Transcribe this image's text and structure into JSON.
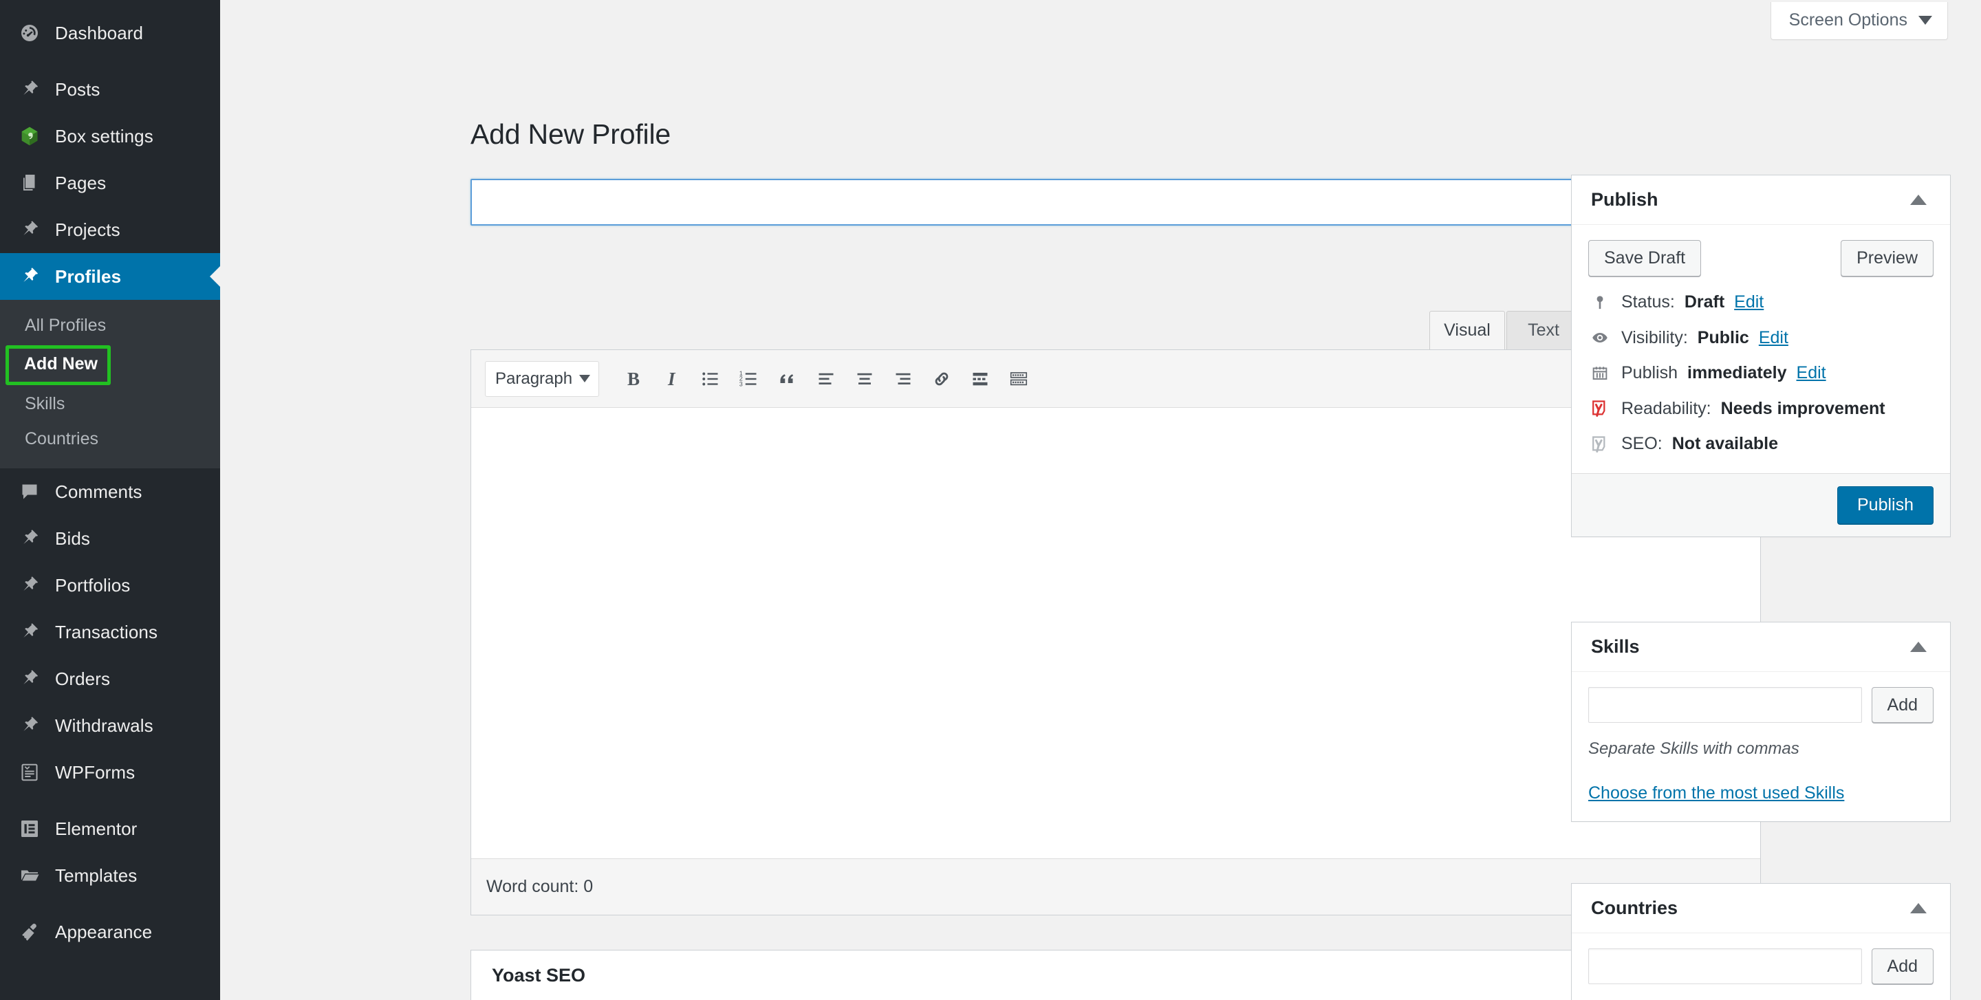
{
  "sidebar": {
    "items": [
      {
        "label": "Dashboard",
        "icon": "dashboard-icon",
        "slug": "dashboard"
      },
      {
        "label": "Posts",
        "icon": "pin-icon",
        "slug": "posts"
      },
      {
        "label": "Box settings",
        "icon": "green-cube-icon",
        "slug": "box-settings"
      },
      {
        "label": "Pages",
        "icon": "pages-icon",
        "slug": "pages"
      },
      {
        "label": "Projects",
        "icon": "pin-icon",
        "slug": "projects"
      },
      {
        "label": "Profiles",
        "icon": "pin-icon",
        "slug": "profiles",
        "active": true
      },
      {
        "label": "Comments",
        "icon": "comment-icon",
        "slug": "comments"
      },
      {
        "label": "Bids",
        "icon": "pin-icon",
        "slug": "bids"
      },
      {
        "label": "Portfolios",
        "icon": "pin-icon",
        "slug": "portfolios"
      },
      {
        "label": "Transactions",
        "icon": "pin-icon",
        "slug": "transactions"
      },
      {
        "label": "Orders",
        "icon": "pin-icon",
        "slug": "orders"
      },
      {
        "label": "Withdrawals",
        "icon": "pin-icon",
        "slug": "withdrawals"
      },
      {
        "label": "WPForms",
        "icon": "wpforms-icon",
        "slug": "wpforms"
      },
      {
        "label": "Elementor",
        "icon": "elementor-icon",
        "slug": "elementor"
      },
      {
        "label": "Templates",
        "icon": "folder-icon",
        "slug": "templates"
      },
      {
        "label": "Appearance",
        "icon": "brush-icon",
        "slug": "appearance"
      }
    ],
    "submenu": [
      {
        "label": "All Profiles",
        "slug": "all-profiles"
      },
      {
        "label": "Add New",
        "slug": "add-new",
        "highlighted": true
      },
      {
        "label": "Skills",
        "slug": "skills"
      },
      {
        "label": "Countries",
        "slug": "countries"
      }
    ],
    "colors": {
      "background": "#23282d",
      "submenu_background": "#32373c",
      "active": "#0073aa",
      "highlight": "#22c022"
    }
  },
  "header": {
    "screen_options_label": "Screen Options",
    "screen_options_icon": "chevron-down-icon"
  },
  "page": {
    "title": "Add New Profile",
    "title_input_value": "",
    "title_input_placeholder": ""
  },
  "editor": {
    "tabs": {
      "visual": "Visual",
      "text": "Text",
      "active": "Visual"
    },
    "format_select": {
      "value": "Paragraph",
      "icon": "chevron-down-icon"
    },
    "toolbar_buttons": [
      {
        "name": "bold-icon",
        "label": "B"
      },
      {
        "name": "italic-icon",
        "label": "I"
      },
      {
        "name": "bulleted-list-icon",
        "label": "Bulleted list"
      },
      {
        "name": "numbered-list-icon",
        "label": "Numbered list"
      },
      {
        "name": "blockquote-icon",
        "label": "Blockquote"
      },
      {
        "name": "align-left-icon",
        "label": "Align left"
      },
      {
        "name": "align-center-icon",
        "label": "Align center"
      },
      {
        "name": "align-right-icon",
        "label": "Align right"
      },
      {
        "name": "link-icon",
        "label": "Insert link"
      },
      {
        "name": "read-more-icon",
        "label": "Insert Read More tag"
      },
      {
        "name": "toolbar-toggle-icon",
        "label": "Toolbar Toggle"
      }
    ],
    "fullscreen_icon": "fullscreen-icon",
    "content": "",
    "word_count_label": "Word count: 0"
  },
  "yoast_metabox": {
    "title": "Yoast SEO",
    "toggle_icon": "chevron-up-icon"
  },
  "publish_box": {
    "title": "Publish",
    "toggle_icon": "chevron-up-icon",
    "save_draft_label": "Save Draft",
    "preview_label": "Preview",
    "rows": [
      {
        "icon": "pin-marker-icon",
        "prefix": "Status:",
        "value": "Draft",
        "link": "Edit"
      },
      {
        "icon": "eye-icon",
        "prefix": "Visibility:",
        "value": "Public",
        "link": "Edit"
      },
      {
        "icon": "calendar-icon",
        "prefix": "Publish",
        "value": "immediately",
        "link": "Edit"
      },
      {
        "icon": "yoast-readability-icon",
        "prefix": "Readability:",
        "value": "Needs improvement",
        "link": ""
      },
      {
        "icon": "yoast-seo-icon",
        "prefix": "SEO:",
        "value": "Not available",
        "link": ""
      }
    ],
    "publish_label": "Publish",
    "publish_color": "#0073aa"
  },
  "skills_box": {
    "title": "Skills",
    "toggle_icon": "chevron-up-icon",
    "input_value": "",
    "add_label": "Add",
    "hint": "Separate Skills with commas",
    "choose_link": "Choose from the most used Skills"
  },
  "countries_box": {
    "title": "Countries",
    "toggle_icon": "chevron-up-icon",
    "input_value": "",
    "add_label": "Add"
  }
}
